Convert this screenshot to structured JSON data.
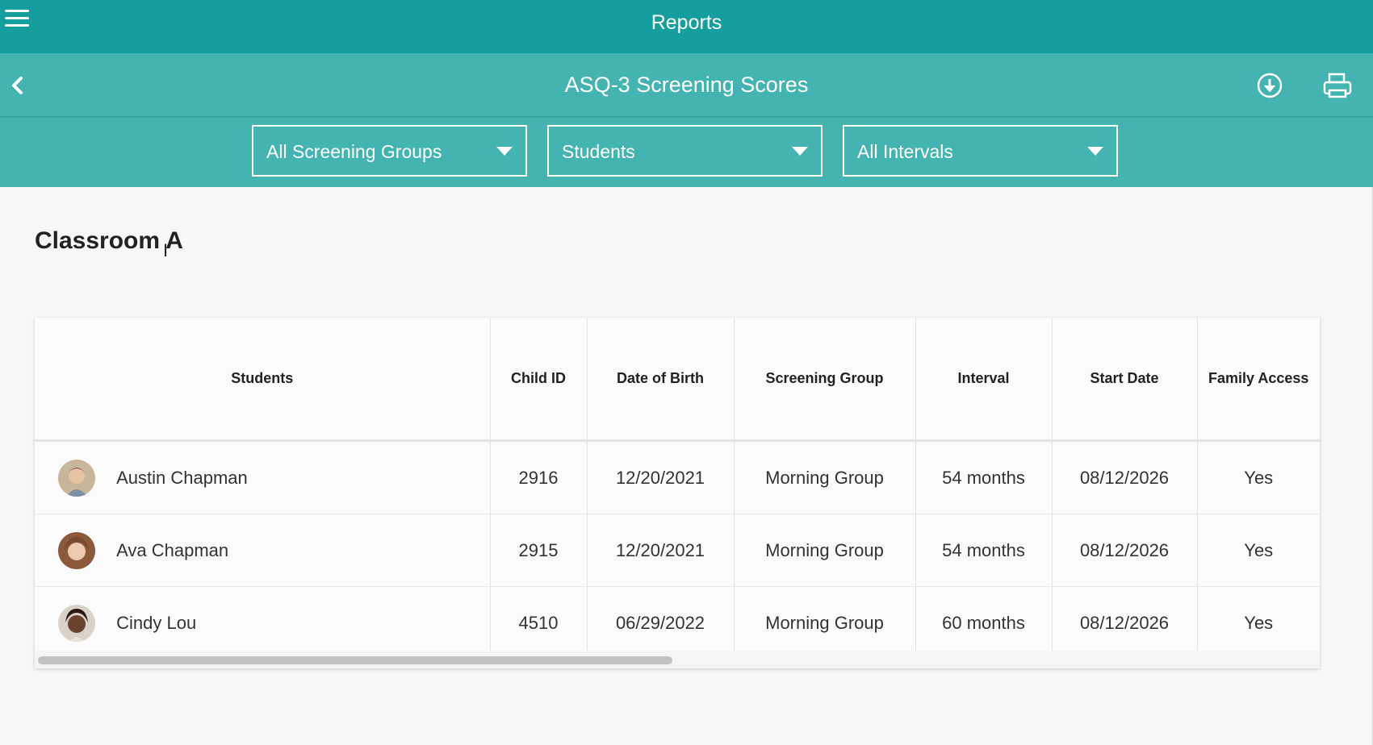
{
  "header": {
    "app_title": "Reports",
    "menu_icon": "hamburger-menu-icon"
  },
  "subheader": {
    "title": "ASQ-3 Screening Scores",
    "back_icon": "chevron-left-icon",
    "download_icon": "download-icon",
    "print_icon": "printer-icon"
  },
  "filters": {
    "groups": "All Screening Groups",
    "view": "Students",
    "intervals": "All Intervals"
  },
  "section": {
    "title": "Classroom A"
  },
  "table": {
    "headers": {
      "students": "Students",
      "child_id": "Child ID",
      "dob": "Date of Birth",
      "group": "Screening Group",
      "interval": "Interval",
      "start_date": "Start Date",
      "family_access": "Family Access"
    },
    "rows": [
      {
        "name": "Austin Chapman",
        "child_id": "2916",
        "dob": "12/20/2021",
        "group": "Morning Group",
        "interval": "54 months",
        "start_date": "08/12/2026",
        "family_access": "Yes"
      },
      {
        "name": "Ava Chapman",
        "child_id": "2915",
        "dob": "12/20/2021",
        "group": "Morning Group",
        "interval": "54 months",
        "start_date": "08/12/2026",
        "family_access": "Yes"
      },
      {
        "name": "Cindy Lou",
        "child_id": "4510",
        "dob": "06/29/2022",
        "group": "Morning Group",
        "interval": "60 months",
        "start_date": "08/12/2026",
        "family_access": "Yes"
      }
    ]
  },
  "colors": {
    "header_teal": "#159e9e",
    "subheader_teal": "#44b4b3",
    "background": "#f7f7f7"
  }
}
